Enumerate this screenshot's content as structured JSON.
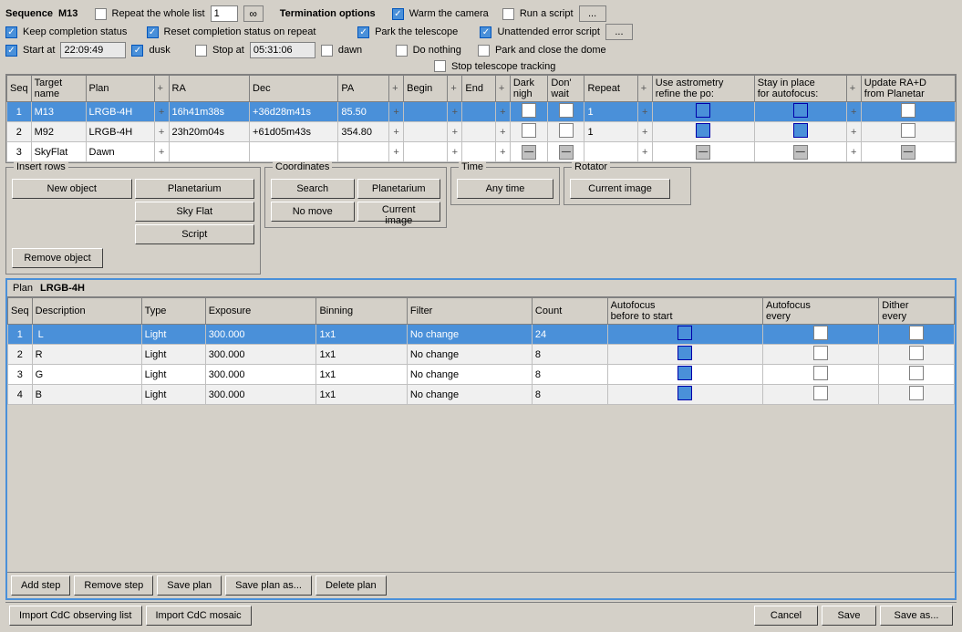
{
  "toolbar": {
    "sequence_label": "Sequence",
    "sequence_value": "M13",
    "repeat_label": "Repeat the whole list",
    "repeat_num": "1",
    "keep_completion_label": "Keep completion status",
    "reset_completion_label": "Reset completion status on repeat",
    "start_at_label": "Start at",
    "start_time": "22:09:49",
    "dusk_label": "dusk",
    "stop_at_label": "Stop at",
    "stop_time": "05:31:06",
    "dawn_label": "dawn"
  },
  "termination": {
    "label": "Termination options",
    "warm_camera_label": "Warm the camera",
    "park_telescope_label": "Park the telescope",
    "park_close_dome_label": "Park and close the dome",
    "do_nothing_label": "Do nothing",
    "stop_tracking_label": "Stop telescope tracking",
    "run_script_label": "Run a script",
    "unattended_error_label": "Unattended error script"
  },
  "main_table": {
    "headers": [
      "Seq",
      "Target name",
      "Plan",
      "+",
      "RA",
      "Dec",
      "PA",
      "+",
      "Begin",
      "+",
      "End",
      "+",
      "Dark nigh",
      "Don' wait",
      "Repeat",
      "+",
      "Use astrometry refine the po:",
      "Stay in place for autofocus",
      "+",
      "Update RA+D from Planetar"
    ],
    "rows": [
      {
        "seq": "1",
        "target": "M13",
        "plan": "LRGB-4H",
        "ra": "16h41m38s",
        "dec": "+36d28m41s",
        "pa": "85.50",
        "begin": "",
        "end": "",
        "dark": false,
        "dont_wait": false,
        "repeat": "1",
        "use_astro": true,
        "stay_in_place": true,
        "update_ra": false,
        "selected": true
      },
      {
        "seq": "2",
        "target": "M92",
        "plan": "LRGB-4H",
        "ra": "23h20m04s",
        "dec": "+61d05m43s",
        "pa": "354.80",
        "begin": "",
        "end": "",
        "dark": false,
        "dont_wait": false,
        "repeat": "1",
        "use_astro": true,
        "stay_in_place": true,
        "update_ra": false,
        "selected": false
      },
      {
        "seq": "3",
        "target": "SkyFlat",
        "plan": "Dawn",
        "ra": "",
        "dec": "",
        "pa": "",
        "begin": "",
        "end": "",
        "dark": "dash",
        "dont_wait": "dash",
        "repeat": "",
        "use_astro": "dash",
        "stay_in_place": "dash",
        "update_ra": "dash",
        "selected": false
      }
    ]
  },
  "insert_rows": {
    "label": "Insert rows",
    "new_object_label": "New object",
    "planetarium_label": "Planetarium",
    "sky_flat_label": "Sky Flat",
    "script_label": "Script",
    "remove_object_label": "Remove object"
  },
  "coordinates": {
    "label": "Coordinates",
    "search_label": "Search",
    "planetarium_label": "Planetarium",
    "no_move_label": "No move",
    "current_image_label": "Current image"
  },
  "time": {
    "label": "Time",
    "any_time_label": "Any time"
  },
  "rotator": {
    "label": "Rotator",
    "current_image_label": "Current image"
  },
  "plan": {
    "label": "Plan",
    "name": "LRGB-4H",
    "headers": [
      "Seq",
      "Description",
      "Type",
      "Exposure",
      "Binning",
      "Filter",
      "Count",
      "Autofocus before to start",
      "Autofocus every",
      "Dither every"
    ],
    "rows": [
      {
        "seq": "1",
        "desc": "L",
        "type": "Light",
        "exposure": "300.000",
        "binning": "1x1",
        "filter": "No change",
        "count": "24",
        "af_before": true,
        "af_every": false,
        "dither": false,
        "selected": true
      },
      {
        "seq": "2",
        "desc": "R",
        "type": "Light",
        "exposure": "300.000",
        "binning": "1x1",
        "filter": "No change",
        "count": "8",
        "af_before": true,
        "af_every": false,
        "dither": false,
        "selected": false
      },
      {
        "seq": "3",
        "desc": "G",
        "type": "Light",
        "exposure": "300.000",
        "binning": "1x1",
        "filter": "No change",
        "count": "8",
        "af_before": true,
        "af_every": false,
        "dither": false,
        "selected": false
      },
      {
        "seq": "4",
        "desc": "B",
        "type": "Light",
        "exposure": "300.000",
        "binning": "1x1",
        "filter": "No change",
        "count": "8",
        "af_before": true,
        "af_every": false,
        "dither": false,
        "selected": false
      }
    ]
  },
  "plan_buttons": {
    "add_step": "Add step",
    "remove_step": "Remove step",
    "save_plan": "Save plan",
    "save_plan_as": "Save plan as...",
    "delete_plan": "Delete plan"
  },
  "footer_buttons": {
    "import_cdc": "Import CdC observing list",
    "import_mosaic": "Import CdC mosaic",
    "cancel": "Cancel",
    "save": "Save",
    "save_as": "Save as..."
  }
}
